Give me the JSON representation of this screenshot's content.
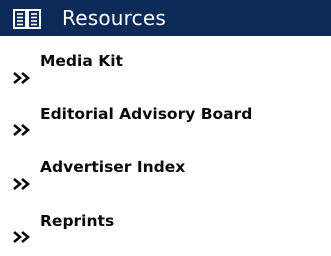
{
  "header": {
    "title": "Resources",
    "icon": "open-book-icon",
    "background_color": "#0b2a57",
    "title_color": "#ffffff"
  },
  "menu": {
    "bullet_icon": "double-chevron-right-icon",
    "items": [
      {
        "label": "Media Kit"
      },
      {
        "label": "Editorial Advisory Board"
      },
      {
        "label": "Advertiser Index"
      },
      {
        "label": "Reprints"
      }
    ]
  }
}
